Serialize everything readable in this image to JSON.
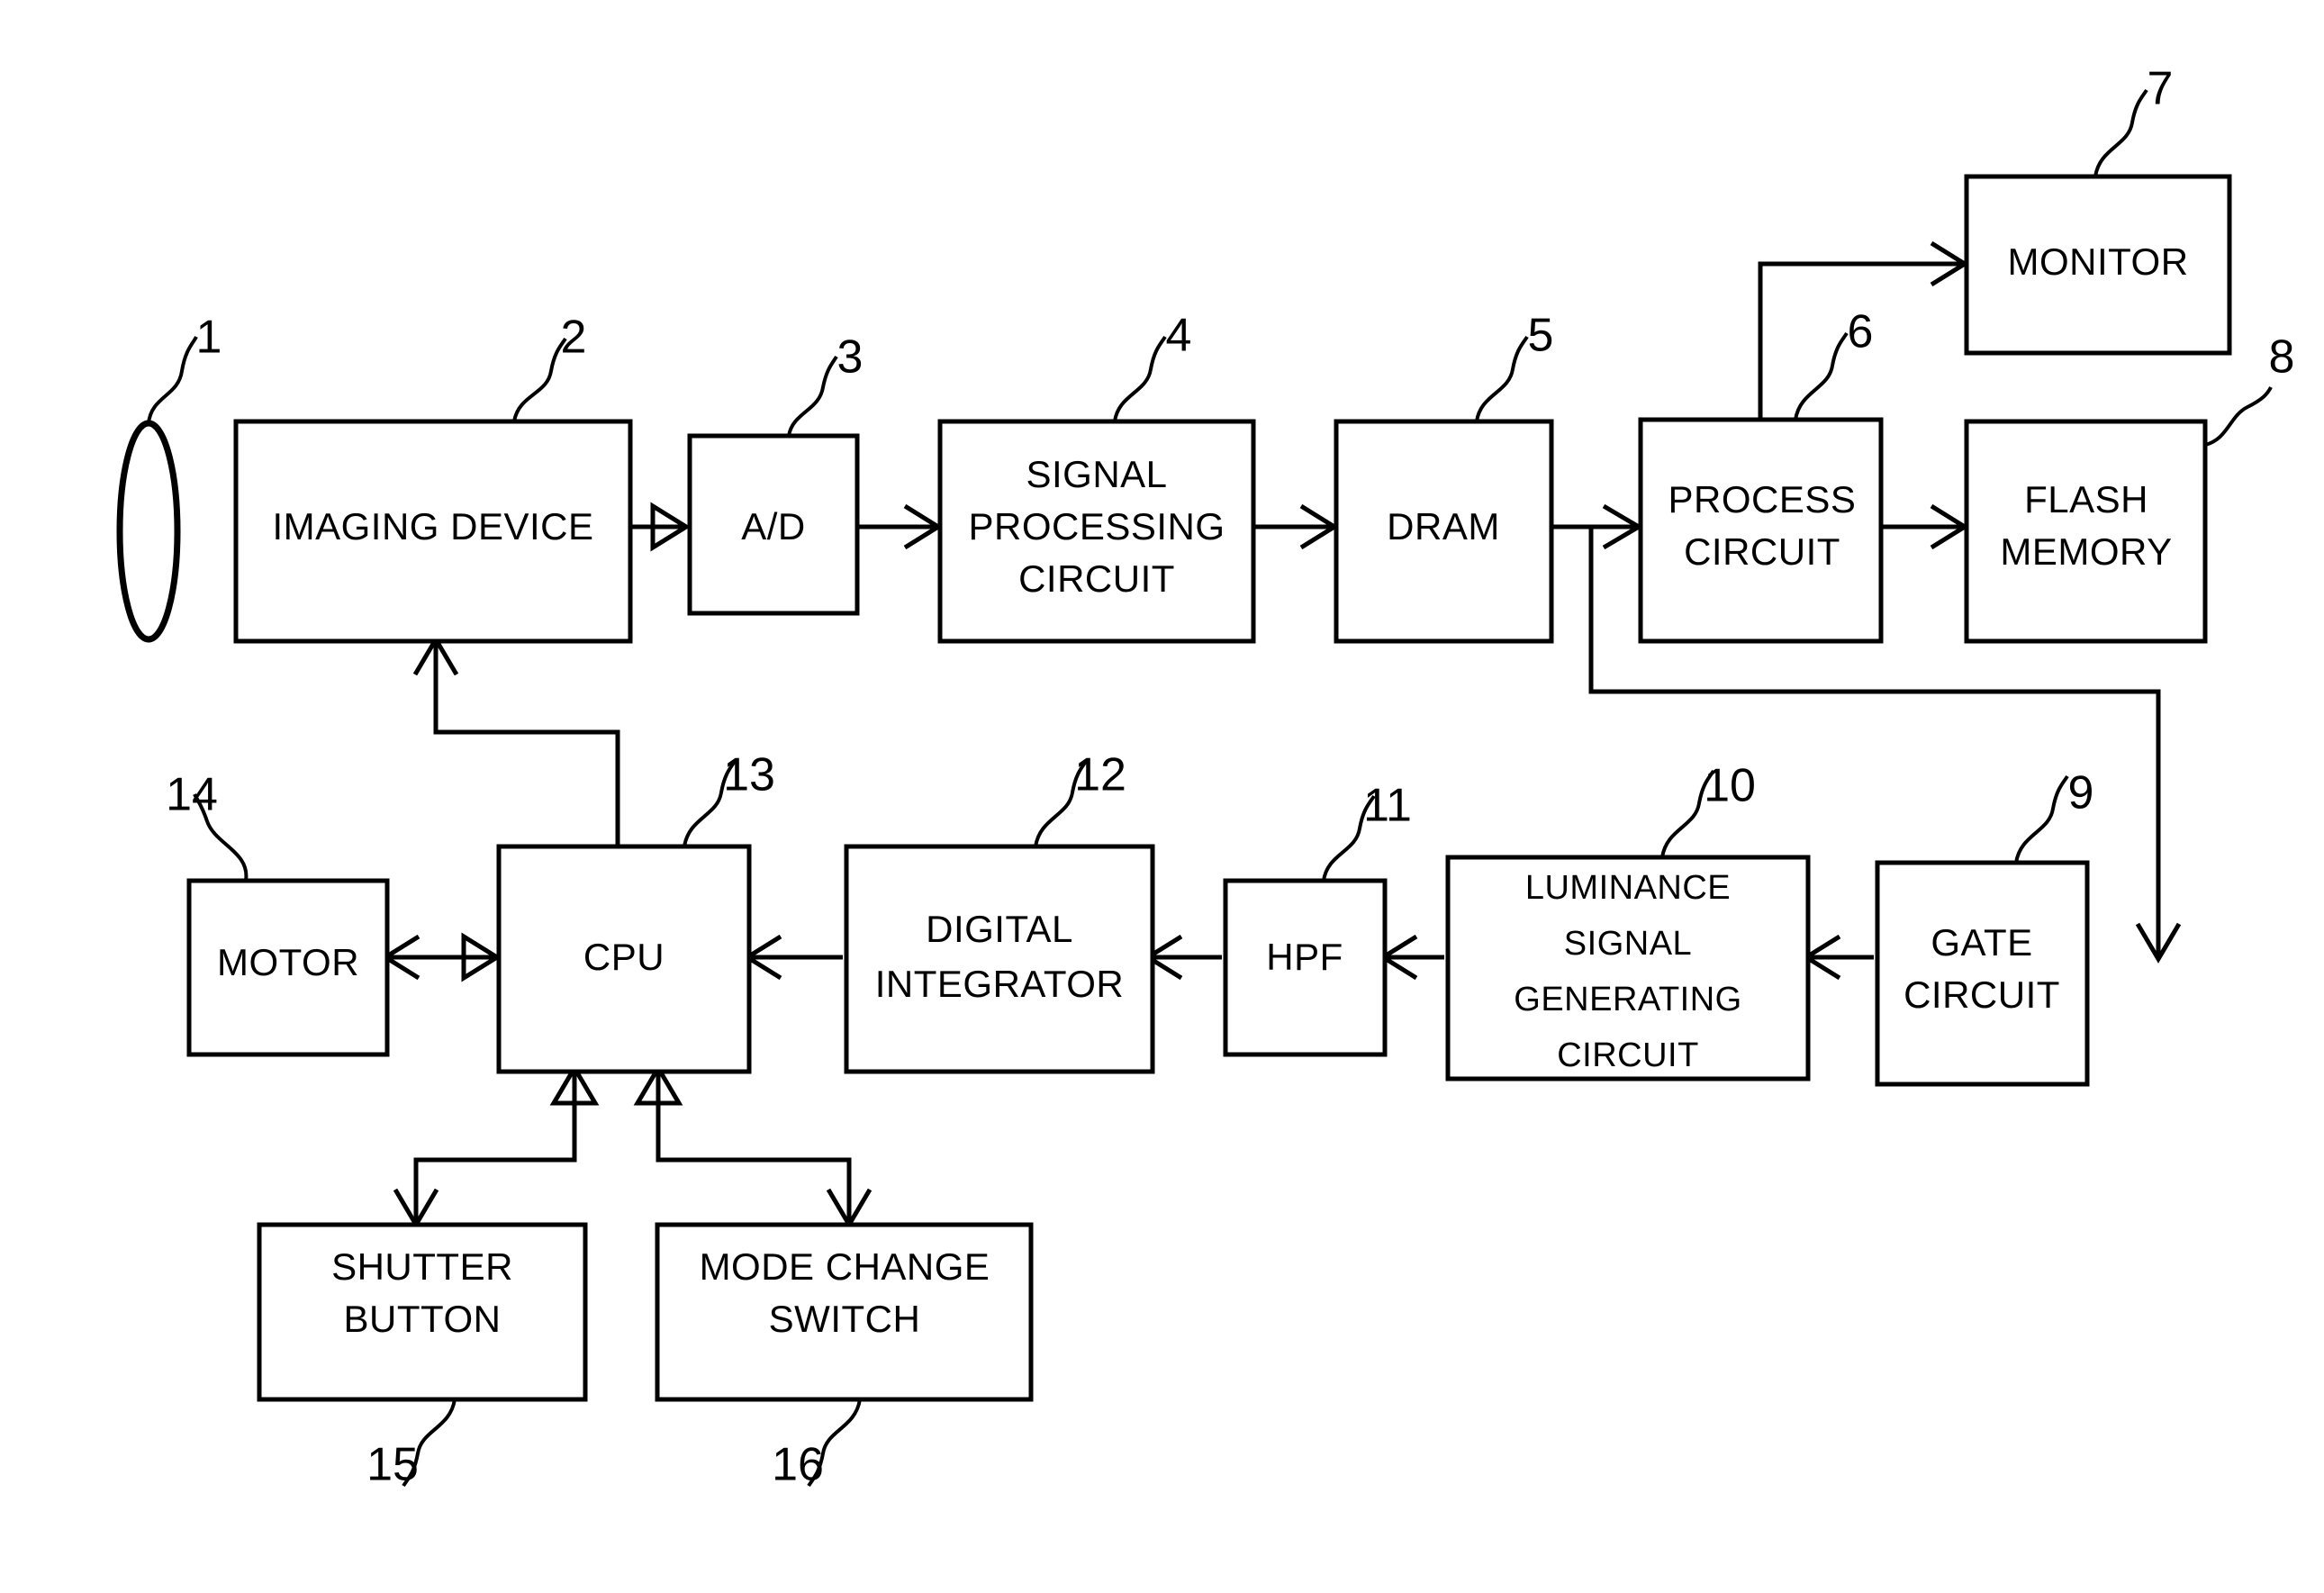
{
  "figure": {
    "kind": "patent-block-diagram",
    "subject": "digital camera autofocus signal path"
  },
  "blocks": [
    {
      "id": "lens",
      "label": "",
      "ref": "1",
      "lines": []
    },
    {
      "id": "imaging-device",
      "label": "IMAGING DEVICE",
      "ref": "2",
      "lines": [
        "IMAGING DEVICE"
      ]
    },
    {
      "id": "ad",
      "label": "A/D",
      "ref": "3",
      "lines": [
        "A/D"
      ]
    },
    {
      "id": "signal-proc",
      "label": "SIGNAL PROCESSING CIRCUIT",
      "ref": "4",
      "lines": [
        "SIGNAL",
        "PROCESSING",
        "CIRCUIT"
      ]
    },
    {
      "id": "dram",
      "label": "DRAM",
      "ref": "5",
      "lines": [
        "DRAM"
      ]
    },
    {
      "id": "process-circuit",
      "label": "PROCESS CIRCUIT",
      "ref": "6",
      "lines": [
        "PROCESS",
        "CIRCUIT"
      ]
    },
    {
      "id": "monitor",
      "label": "MONITOR",
      "ref": "7",
      "lines": [
        "MONITOR"
      ]
    },
    {
      "id": "flash-memory",
      "label": "FLASH MEMORY",
      "ref": "8",
      "lines": [
        "FLASH",
        "MEMORY"
      ]
    },
    {
      "id": "gate-circuit",
      "label": "GATE CIRCUIT",
      "ref": "9",
      "lines": [
        "GATE",
        "CIRCUIT"
      ]
    },
    {
      "id": "luminance",
      "label": "LUMINANCE SIGNAL GENERATING CIRCUIT",
      "ref": "10",
      "lines": [
        "LUMINANCE",
        "SIGNAL",
        "GENERATING",
        "CIRCUIT"
      ]
    },
    {
      "id": "hpf",
      "label": "HPF",
      "ref": "11",
      "lines": [
        "HPF"
      ]
    },
    {
      "id": "digital-integ",
      "label": "DIGITAL INTEGRATOR",
      "ref": "12",
      "lines": [
        "DIGITAL",
        "INTEGRATOR"
      ]
    },
    {
      "id": "cpu",
      "label": "CPU",
      "ref": "13",
      "lines": [
        "CPU"
      ]
    },
    {
      "id": "motor",
      "label": "MOTOR",
      "ref": "14",
      "lines": [
        "MOTOR"
      ]
    },
    {
      "id": "shutter-button",
      "label": "SHUTTER BUTTON",
      "ref": "15",
      "lines": [
        "SHUTTER",
        "BUTTON"
      ]
    },
    {
      "id": "mode-switch",
      "label": "MODE CHANGE SWITCH",
      "ref": "16",
      "lines": [
        "MODE CHANGE",
        "SWITCH"
      ]
    }
  ],
  "labels": {
    "imaging_device": "IMAGING DEVICE",
    "ad": "A/D",
    "signal_l1": "SIGNAL",
    "signal_l2": "PROCESSING",
    "signal_l3": "CIRCUIT",
    "dram": "DRAM",
    "process_l1": "PROCESS",
    "process_l2": "CIRCUIT",
    "monitor": "MONITOR",
    "flash_l1": "FLASH",
    "flash_l2": "MEMORY",
    "gate_l1": "GATE",
    "gate_l2": "CIRCUIT",
    "lum_l1": "LUMINANCE",
    "lum_l2": "SIGNAL",
    "lum_l3": "GENERATING",
    "lum_l4": "CIRCUIT",
    "hpf": "HPF",
    "digint_l1": "DIGITAL",
    "digint_l2": "INTEGRATOR",
    "cpu": "CPU",
    "motor": "MOTOR",
    "shutter_l1": "SHUTTER",
    "shutter_l2": "BUTTON",
    "mode_l1": "MODE CHANGE",
    "mode_l2": "SWITCH"
  },
  "refs": {
    "n1": "1",
    "n2": "2",
    "n3": "3",
    "n4": "4",
    "n5": "5",
    "n6": "6",
    "n7": "7",
    "n8": "8",
    "n9": "9",
    "n10": "10",
    "n11": "11",
    "n12": "12",
    "n13": "13",
    "n14": "14",
    "n15": "15",
    "n16": "16"
  },
  "connections": [
    {
      "from": "imaging-device",
      "to": "ad",
      "style": "arrow"
    },
    {
      "from": "ad",
      "to": "signal-proc",
      "style": "arrow"
    },
    {
      "from": "signal-proc",
      "to": "dram",
      "style": "arrow"
    },
    {
      "from": "dram",
      "to": "process-circuit",
      "style": "arrow"
    },
    {
      "from": "process-circuit",
      "to": "monitor",
      "style": "arrow"
    },
    {
      "from": "process-circuit",
      "to": "flash-memory",
      "style": "arrow"
    },
    {
      "from": "dram-branch",
      "to": "gate-circuit",
      "style": "arrow"
    },
    {
      "from": "gate-circuit",
      "to": "luminance",
      "style": "arrow"
    },
    {
      "from": "luminance",
      "to": "hpf",
      "style": "arrow"
    },
    {
      "from": "hpf",
      "to": "digital-integ",
      "style": "arrow"
    },
    {
      "from": "digital-integ",
      "to": "cpu",
      "style": "arrow"
    },
    {
      "from": "cpu",
      "to": "motor",
      "style": "double-arrow"
    },
    {
      "from": "cpu",
      "to": "imaging-device",
      "style": "arrow"
    },
    {
      "from": "shutter-button",
      "to": "cpu",
      "style": "double-arrow"
    },
    {
      "from": "mode-switch",
      "to": "cpu",
      "style": "double-arrow"
    }
  ],
  "colors": {
    "stroke": "#000000",
    "fill": "#ffffff",
    "background": "#ffffff"
  }
}
